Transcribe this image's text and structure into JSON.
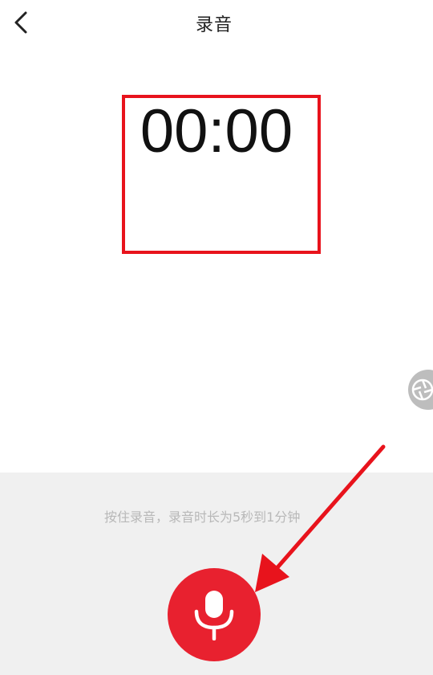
{
  "header": {
    "title": "录音",
    "back_icon": "chevron-left-icon"
  },
  "timer": {
    "value": "00:00"
  },
  "recorder": {
    "hint": "按住录音，录音时长为5秒到1分钟",
    "mic_icon": "microphone-icon"
  },
  "floating_button": {
    "icon": "shutter-icon"
  },
  "annotations": {
    "color": "#e8131c",
    "highlight_target": "timer",
    "arrow_target": "mic-button"
  },
  "colors": {
    "accent": "#e8212f",
    "panel_background": "#f0f0f0",
    "hint_text": "#b8b8b8"
  }
}
